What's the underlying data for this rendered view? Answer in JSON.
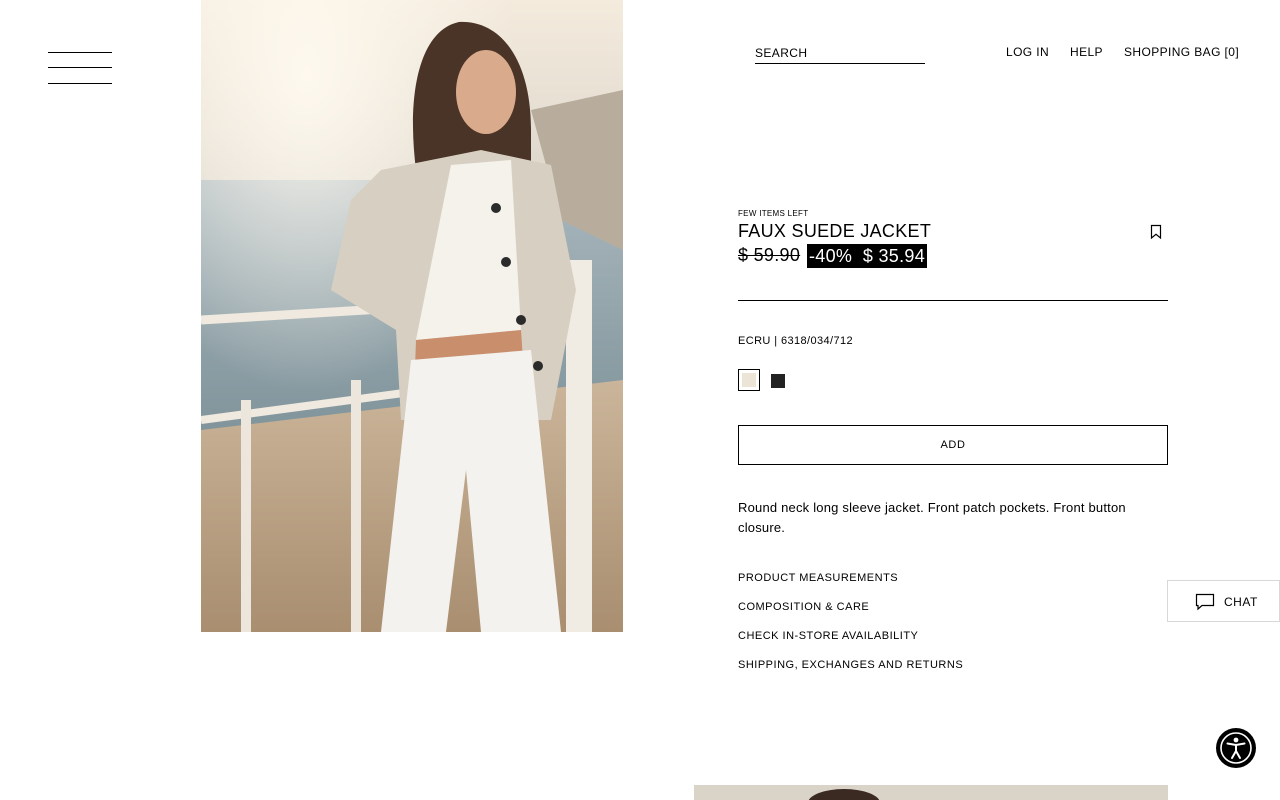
{
  "header": {
    "search_placeholder": "SEARCH",
    "login": "LOG IN",
    "help": "HELP",
    "bag": "SHOPPING BAG [0]"
  },
  "product": {
    "stock_note": "FEW ITEMS LEFT",
    "name": "FAUX SUEDE JACKET",
    "price_original": "$ 59.90",
    "discount": "-40%",
    "price_sale": "$ 35.94",
    "color_ref": "ECRU | 6318/034/712",
    "colors": [
      {
        "name": "ecru",
        "hex": "#ece4d6",
        "selected": true
      },
      {
        "name": "black",
        "hex": "#222222",
        "selected": false
      }
    ],
    "add_label": "ADD",
    "description": "Round neck long sleeve jacket. Front patch pockets. Front button closure.",
    "links": [
      "PRODUCT MEASUREMENTS",
      "COMPOSITION & CARE",
      "CHECK IN-STORE AVAILABILITY",
      "SHIPPING, EXCHANGES AND RETURNS"
    ]
  },
  "chat": {
    "label": "CHAT"
  },
  "icons": [
    "menu-icon",
    "bookmark-icon",
    "chat-icon",
    "accessibility-icon"
  ]
}
